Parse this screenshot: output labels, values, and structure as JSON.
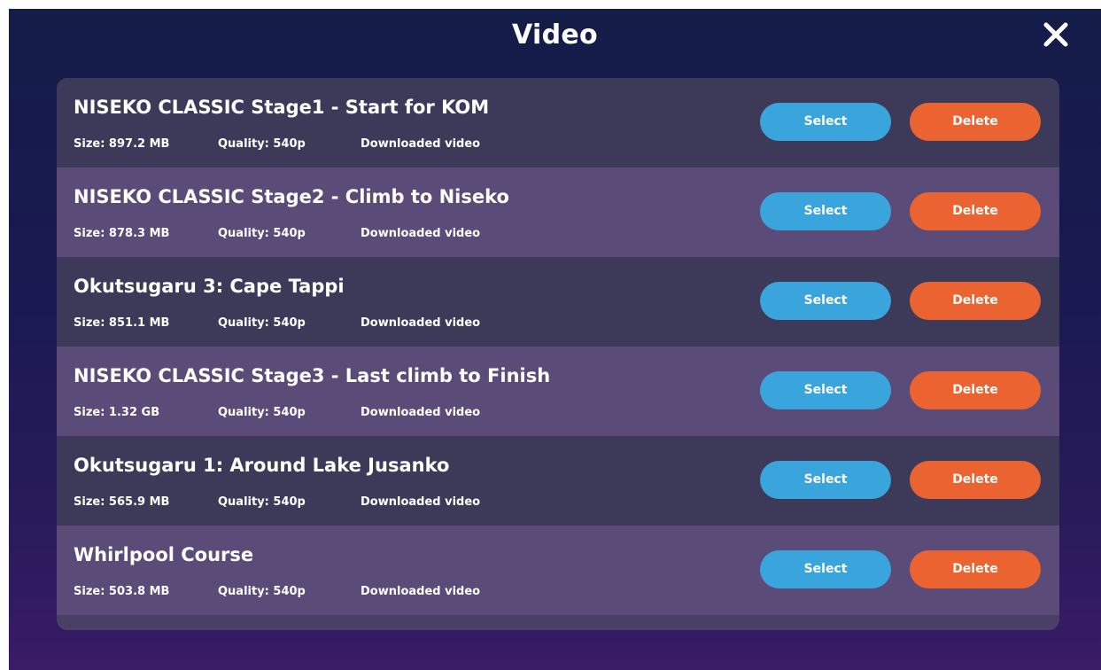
{
  "header": {
    "title": "Video"
  },
  "colors": {
    "select_button": "#3aa4dc",
    "delete_button": "#ea6330"
  },
  "icons": {
    "close": "close-icon"
  },
  "videos": [
    {
      "title": "NISEKO CLASSIC Stage1 - Start for KOM",
      "size": "Size: 897.2 MB",
      "quality": "Quality: 540p",
      "status": "Downloaded video",
      "select_label": "Select",
      "delete_label": "Delete"
    },
    {
      "title": "NISEKO CLASSIC Stage2 - Climb to Niseko",
      "size": "Size: 878.3 MB",
      "quality": "Quality: 540p",
      "status": "Downloaded video",
      "select_label": "Select",
      "delete_label": "Delete"
    },
    {
      "title": "Okutsugaru 3: Cape Tappi",
      "size": "Size: 851.1 MB",
      "quality": "Quality: 540p",
      "status": "Downloaded video",
      "select_label": "Select",
      "delete_label": "Delete"
    },
    {
      "title": "NISEKO CLASSIC Stage3 - Last climb to Finish",
      "size": "Size: 1.32 GB",
      "quality": "Quality: 540p",
      "status": "Downloaded video",
      "select_label": "Select",
      "delete_label": "Delete"
    },
    {
      "title": "Okutsugaru 1: Around Lake Jusanko",
      "size": "Size: 565.9 MB",
      "quality": "Quality: 540p",
      "status": "Downloaded video",
      "select_label": "Select",
      "delete_label": "Delete"
    },
    {
      "title": "Whirlpool Course",
      "size": "Size: 503.8 MB",
      "quality": "Quality: 540p",
      "status": "Downloaded video",
      "select_label": "Select",
      "delete_label": "Delete"
    }
  ]
}
